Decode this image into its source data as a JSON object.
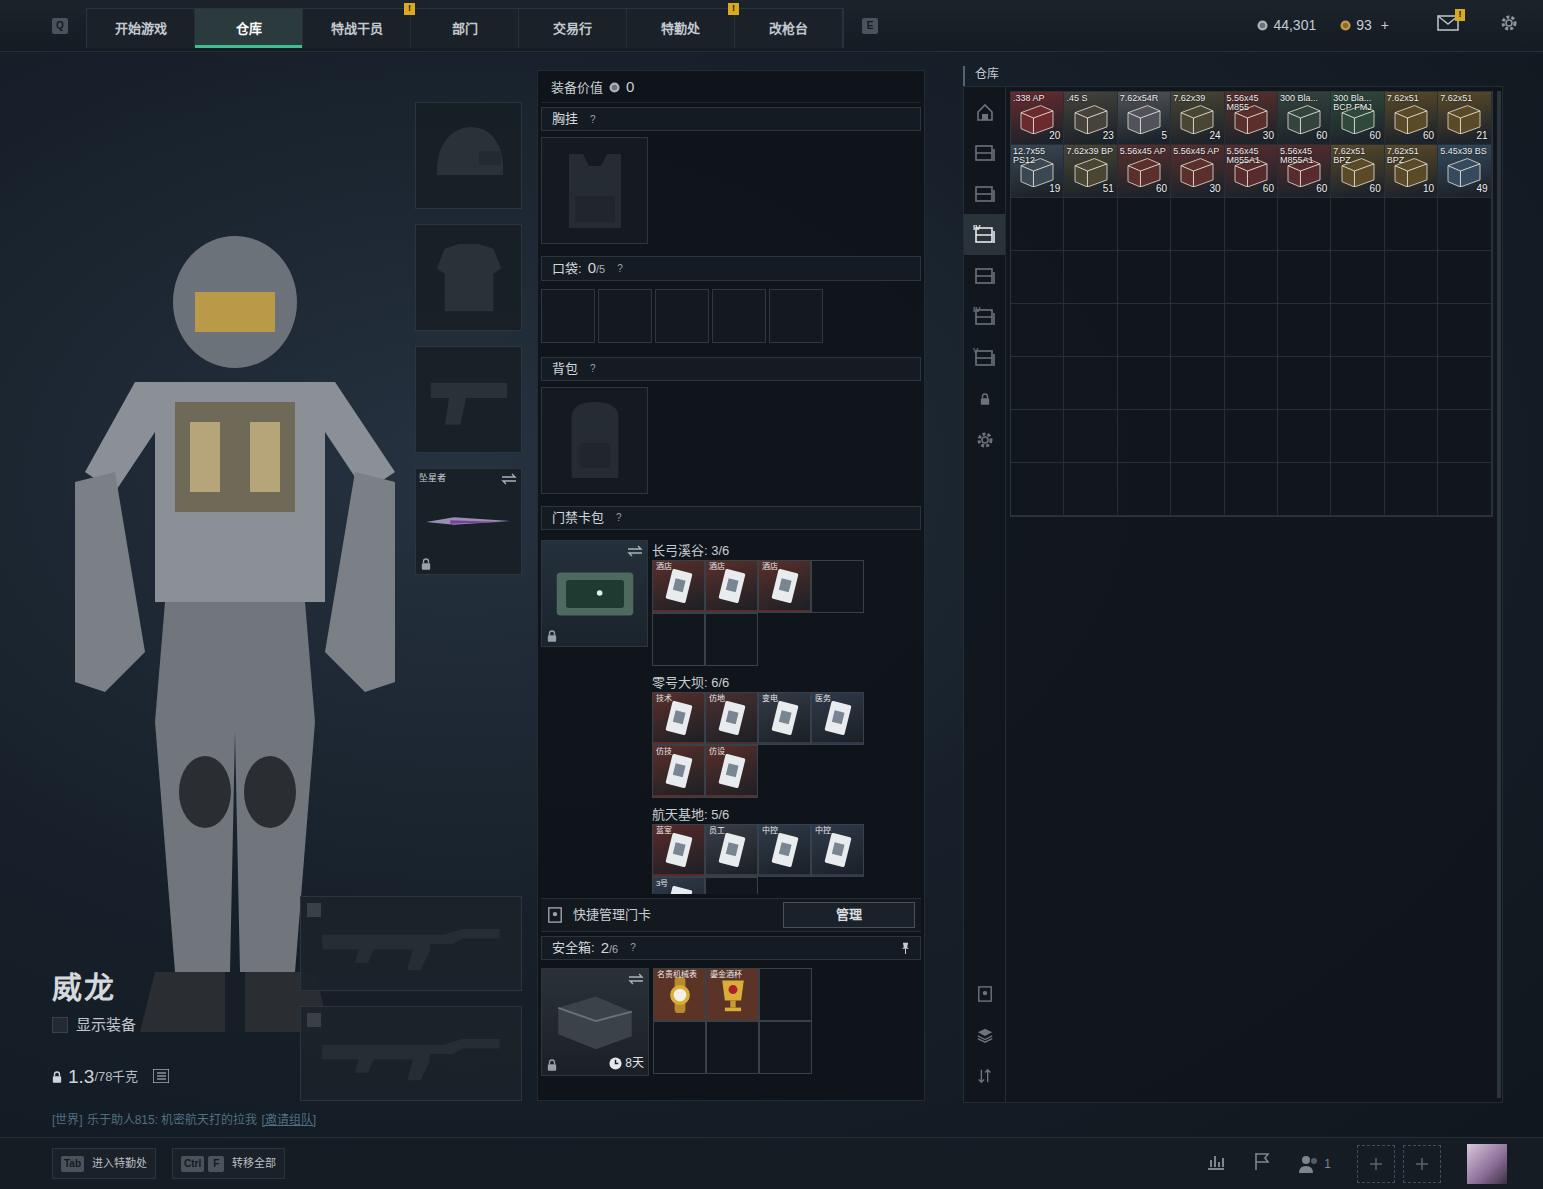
{
  "topbar": {
    "key_left": "Q",
    "tabs": [
      {
        "label": "开始游戏",
        "selected": false
      },
      {
        "label": "仓库",
        "selected": true
      },
      {
        "label": "特战干员",
        "selected": false,
        "badge": "!"
      },
      {
        "label": "部门",
        "selected": false
      },
      {
        "label": "交易行",
        "selected": false
      },
      {
        "label": "特勤处",
        "selected": false,
        "badge": "!"
      },
      {
        "label": "改枪台",
        "selected": false
      }
    ],
    "key_right": "E",
    "coins": "44,301",
    "tokens": "93",
    "tokens_add": "+",
    "mail_badge": "!"
  },
  "operator": {
    "name": "威龙",
    "show_equipment": {
      "label": "显示装备",
      "checked": false
    },
    "weight": "1.3",
    "weight_max": "/78千克"
  },
  "equipment_slots": [
    {
      "kind": "helmet"
    },
    {
      "kind": "armor"
    },
    {
      "kind": "pistol"
    },
    {
      "kind": "melee",
      "label": "坠星者",
      "locked": true
    }
  ],
  "weapon_slots": [
    {
      "kind": "rifle"
    },
    {
      "kind": "rifle"
    }
  ],
  "chat": {
    "channel": "[世界]",
    "message": "乐于助人815: 机密航天打的拉我",
    "action": "[邀请组队]"
  },
  "loadout": {
    "value_label": "装备价值",
    "value": "0",
    "chest_rig": {
      "title": "胸挂",
      "help": "?"
    },
    "pockets": {
      "title": "口袋:",
      "used": "0",
      "capacity": "/5",
      "help": "?",
      "slots": [
        {
          "filled": false
        },
        {
          "filled": false
        },
        {
          "filled": false
        },
        {
          "filled": false
        },
        {
          "filled": false
        }
      ]
    },
    "backpack": {
      "title": "背包",
      "help": "?"
    },
    "keycards": {
      "title": "门禁卡包",
      "help": "?",
      "locked": true,
      "groups": [
        {
          "map": "长弓溪谷: 3/6",
          "cards": [
            {
              "kind": "card",
              "label": "酒店",
              "color": "#5a2f2a"
            },
            {
              "kind": "card",
              "label": "酒店",
              "color": "#5a2f2a"
            },
            {
              "kind": "card",
              "label": "酒店",
              "color": "#5a2f2a"
            },
            {
              "kind": "empty"
            },
            {
              "kind": "empty"
            },
            {
              "kind": "empty"
            }
          ]
        },
        {
          "map": "零号大坝: 6/6",
          "cards": [
            {
              "kind": "card",
              "label": "技术",
              "color": "#5a2f2a"
            },
            {
              "kind": "card",
              "label": "仿地",
              "color": "#4a3030"
            },
            {
              "kind": "card",
              "label": "变电",
              "color": "#343b46"
            },
            {
              "kind": "card",
              "label": "医务",
              "color": "#2f3a48"
            },
            {
              "kind": "card",
              "label": "仿技",
              "color": "#5a2f2a"
            },
            {
              "kind": "card",
              "label": "仿设",
              "color": "#5a2f2a"
            }
          ]
        },
        {
          "map": "航天基地: 5/6",
          "cards": [
            {
              "kind": "card",
              "label": "蓝室",
              "color": "#5a2a2a"
            },
            {
              "kind": "card",
              "label": "员工",
              "color": "#3a3d46"
            },
            {
              "kind": "card",
              "label": "中控",
              "color": "#2f3a4a"
            },
            {
              "kind": "card",
              "label": "中控",
              "color": "#2f3a4a"
            },
            {
              "kind": "card",
              "label": "3号",
              "color": "#2f3a4a"
            },
            {
              "kind": "empty"
            }
          ]
        }
      ]
    },
    "quick_manage": {
      "label": "快捷管理门卡",
      "button": "管理"
    },
    "safe_box": {
      "title": "安全箱:",
      "used": "2",
      "capacity": "/6",
      "help": "?",
      "timer": "8天",
      "locked": true,
      "slots": [
        {
          "kind": "watch",
          "label": "名贵机械表"
        },
        {
          "kind": "cup",
          "label": "鎏金酒杯"
        },
        {
          "kind": "empty"
        },
        {
          "kind": "empty"
        },
        {
          "kind": "empty"
        },
        {
          "kind": "empty"
        }
      ]
    }
  },
  "warehouse": {
    "title": "仓库",
    "sidebar": [
      {
        "kind": "all",
        "selected": false
      },
      {
        "kind": "shelf",
        "selected": false
      },
      {
        "kind": "shelf",
        "selected": false
      },
      {
        "kind": "shelf",
        "label": "IV",
        "selected": true
      },
      {
        "kind": "shelf",
        "selected": false
      },
      {
        "kind": "shelf",
        "label": "IV",
        "selected": false
      },
      {
        "kind": "shelf",
        "label": "V",
        "selected": false
      },
      {
        "kind": "lock",
        "selected": false
      },
      {
        "kind": "gear",
        "selected": false
      }
    ],
    "tools": [
      {
        "kind": "idcard"
      },
      {
        "kind": "layers"
      },
      {
        "kind": "sort"
      }
    ],
    "items": [
      {
        "label": ".338 AP",
        "count": "20",
        "color": "#6a2a2e"
      },
      {
        "label": ".45 S",
        "count": "23",
        "color": "#45433b"
      },
      {
        "label": "7.62x54R",
        "count": "5",
        "color": "#50545a"
      },
      {
        "label": "7.62x39",
        "count": "24",
        "color": "#4a4634"
      },
      {
        "label": "5.56x45 M855",
        "count": "30",
        "color": "#5a2f2c"
      },
      {
        "label": "300 Bla...",
        "count": "60",
        "color": "#33443f"
      },
      {
        "label": "300 Bla... BCP FMJ",
        "count": "60",
        "color": "#2f4a3c"
      },
      {
        "label": "7.62x51",
        "count": "60",
        "color": "#5a4a28"
      },
      {
        "label": "7.62x51",
        "count": "21",
        "color": "#5a4a28"
      },
      {
        "label": "12.7x55 PS12",
        "count": "19",
        "color": "#3a4854"
      },
      {
        "label": "7.62x39 BP",
        "count": "51",
        "color": "#4a4634"
      },
      {
        "label": "5.56x45 AP",
        "count": "60",
        "color": "#5a2f2c"
      },
      {
        "label": "5.56x45 AP",
        "count": "30",
        "color": "#5a2f2c"
      },
      {
        "label": "5.56x45 M855A1",
        "count": "60",
        "color": "#582c2e"
      },
      {
        "label": "5.56x45 M855A1",
        "count": "60",
        "color": "#582c2e"
      },
      {
        "label": "7.62x51 BPZ",
        "count": "60",
        "color": "#5a4a28"
      },
      {
        "label": "7.62x51 BPZ",
        "count": "10",
        "color": "#5a4a28"
      },
      {
        "label": "5.45x39 BS",
        "count": "49",
        "color": "#354a5e"
      }
    ]
  },
  "bottombar": {
    "hints": [
      {
        "keys": [
          "Tab"
        ],
        "label": "进入特勤处"
      },
      {
        "keys": [
          "Ctrl",
          "F"
        ],
        "label": "转移全部"
      }
    ],
    "friends": "1"
  }
}
